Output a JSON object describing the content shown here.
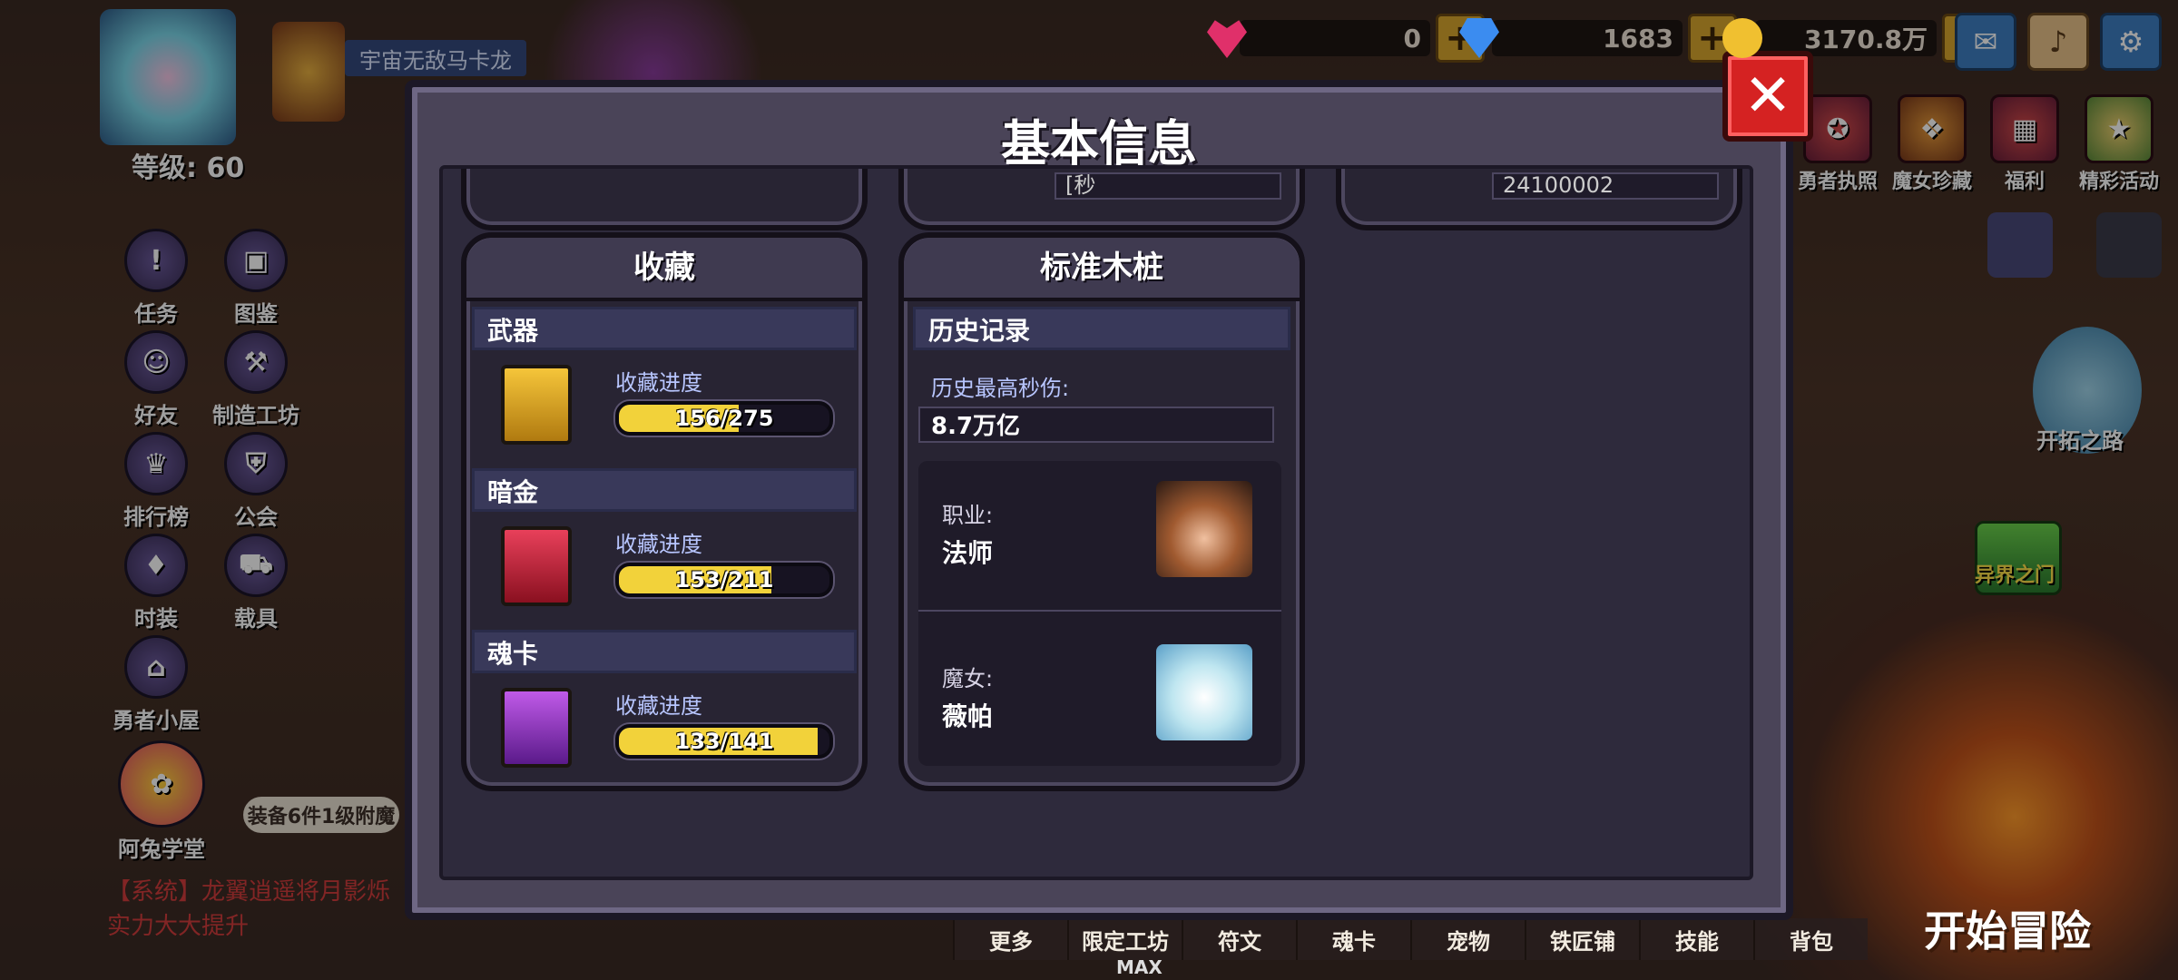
{
  "hud": {
    "player_name": "宇宙无敌马卡龙",
    "level": "等级: 60",
    "resources": [
      {
        "icon": "heart-gem-icon",
        "value": "0",
        "color": "#e0306a"
      },
      {
        "icon": "blue-diamond-icon",
        "value": "1683",
        "color": "#3b8cf0"
      },
      {
        "icon": "gold-coin-icon",
        "value": "3170.8万",
        "color": "#f0c030"
      }
    ],
    "plus": "+",
    "left_menu": [
      "任务",
      "图鉴",
      "好友",
      "制造工坊",
      "排行榜",
      "公会",
      "时装",
      "载具",
      "勇者小屋",
      "阿兔学堂"
    ],
    "right_menu": [
      "勇者执照",
      "魔女珍藏",
      "福利",
      "精彩活动"
    ],
    "kaituo": "开拓之路",
    "yijie": "异界之门",
    "equip_tip": "装备6件1级附魔",
    "chat_line1": "【系统】龙翼逍遥将月影烁",
    "chat_line2": "实力大大提升",
    "bottom_tabs": [
      "更多",
      "限定工坊",
      "符文",
      "魂卡",
      "宠物",
      "铁匠铺",
      "技能",
      "背包"
    ],
    "max_label": "MAX",
    "start_button": "开始冒险"
  },
  "dialog": {
    "title": "基本信息",
    "close": "✕",
    "top_partial": [
      "[秒",
      "24100002"
    ],
    "collection": {
      "title": "收藏",
      "sections": [
        {
          "name": "武器",
          "progress_label": "收藏进度",
          "current": 156,
          "total": 275,
          "text": "156/275",
          "color": "#e8b820"
        },
        {
          "name": "暗金",
          "progress_label": "收藏进度",
          "current": 153,
          "total": 211,
          "text": "153/211",
          "color": "#d4243e"
        },
        {
          "name": "魂卡",
          "progress_label": "收藏进度",
          "current": 133,
          "total": 141,
          "text": "133/141",
          "color": "#a436d8"
        }
      ]
    },
    "dummy": {
      "title": "标准木桩",
      "history_header": "历史记录",
      "max_dps_label": "历史最高秒伤:",
      "max_dps_value": "8.7万亿",
      "class_label": "职业:",
      "class_value": "法师",
      "witch_label": "魔女:",
      "witch_value": "薇帕"
    }
  }
}
